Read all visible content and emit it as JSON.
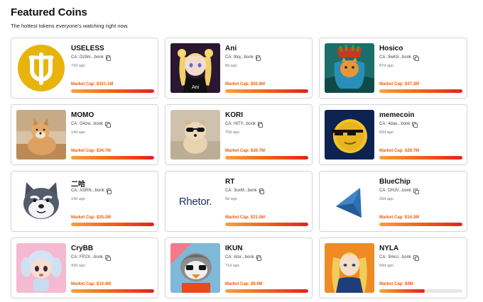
{
  "header": {
    "title": "Featured Coins",
    "subtitle": "The hottest tokens everyone’s watching right now."
  },
  "ca_label": "CA:",
  "accent_color": "#f25c05",
  "coins": [
    {
      "name": "USELESS",
      "ca": "Dz9m...bonk",
      "age": "73d ago",
      "mcap": "Market Cap: $321.1M",
      "progress": 1.0
    },
    {
      "name": "Ani",
      "ca": "9toj...bonk",
      "age": "8d ago",
      "mcap": "Market Cap: $55.8M",
      "progress": 1.0,
      "image_caption": "Ani"
    },
    {
      "name": "Hosico",
      "ca": "9wK8...bonk",
      "age": "87d ago",
      "mcap": "Market Cap: $37.3M",
      "progress": 1.0
    },
    {
      "name": "MOMO",
      "ca": "G4zw...bonk",
      "age": "14d ago",
      "mcap": "Market Cap: $34.7M",
      "progress": 1.0
    },
    {
      "name": "KORI",
      "ca": "HtTY...bonk",
      "age": "70d ago",
      "mcap": "Market Cap: $30.7M",
      "progress": 1.0
    },
    {
      "name": "memecoin",
      "ca": "4dao...bonk",
      "age": "83d ago",
      "mcap": "Market Cap: $29.7M",
      "progress": 1.0
    },
    {
      "name": "二哈",
      "ca": "ASRN...bonk",
      "age": "14d ago",
      "mcap": "Market Cap: $25.2M",
      "progress": 1.0
    },
    {
      "name": "RT",
      "ca": "3uxM...bonk",
      "age": "9d ago",
      "mcap": "Market Cap: $21.5M",
      "progress": 1.0,
      "logo_text": "Rhetor."
    },
    {
      "name": "BlueChip",
      "ca": "DHJV...bonk",
      "age": "26d ago",
      "mcap": "Market Cap: $14.3M",
      "progress": 1.0
    },
    {
      "name": "CryBB",
      "ca": "FP2X...bonk",
      "age": "43d ago",
      "mcap": "Market Cap: $10.4M",
      "progress": 1.0
    },
    {
      "name": "IKUN",
      "ca": "Ator...bonk",
      "age": "71d ago",
      "mcap": "Market Cap: $9.9M",
      "progress": 1.0
    },
    {
      "name": "NYLA",
      "ca": "3HxU...bonk",
      "age": "59d ago",
      "mcap": "Market Cap: $9M",
      "progress": 0.55
    }
  ]
}
